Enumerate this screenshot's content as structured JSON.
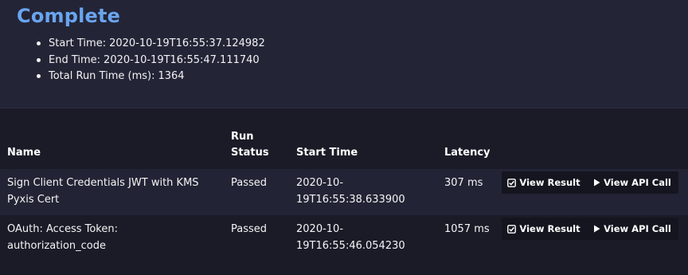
{
  "summary": {
    "title": "Complete",
    "items": [
      {
        "label": "Start Time:",
        "value": "2020-10-19T16:55:37.124982"
      },
      {
        "label": "End Time:",
        "value": "2020-10-19T16:55:47.111740"
      },
      {
        "label": "Total Run Time (ms):",
        "value": "1364"
      }
    ]
  },
  "table": {
    "headers": {
      "name": "Name",
      "run_status_line1": "Run",
      "run_status_line2": "Status",
      "start_time": "Start Time",
      "latency": "Latency"
    },
    "rows": [
      {
        "name_line1": "Sign Client Credentials JWT with KMS",
        "name_line2": "Pyxis Cert",
        "status": "Passed",
        "start_line1": "2020-10-",
        "start_line2": "19T16:55:38.633900",
        "latency": "307 ms",
        "view_result": "View Result",
        "view_api_call": "View API Call"
      },
      {
        "name_line1": "OAuth: Access Token:",
        "name_line2": "authorization_code",
        "status": "Passed",
        "start_line1": "2020-10-",
        "start_line2": "19T16:55:46.054230",
        "latency": "1057 ms",
        "view_result": "View Result",
        "view_api_call": "View API Call"
      }
    ]
  },
  "colors": {
    "title": "#6aa4ef",
    "summary_bg": "#232537",
    "page_bg": "#1b1b28",
    "button_bg": "#14151f"
  },
  "icons": {
    "view_result": "check-square-icon",
    "view_api_call": "play-icon"
  }
}
